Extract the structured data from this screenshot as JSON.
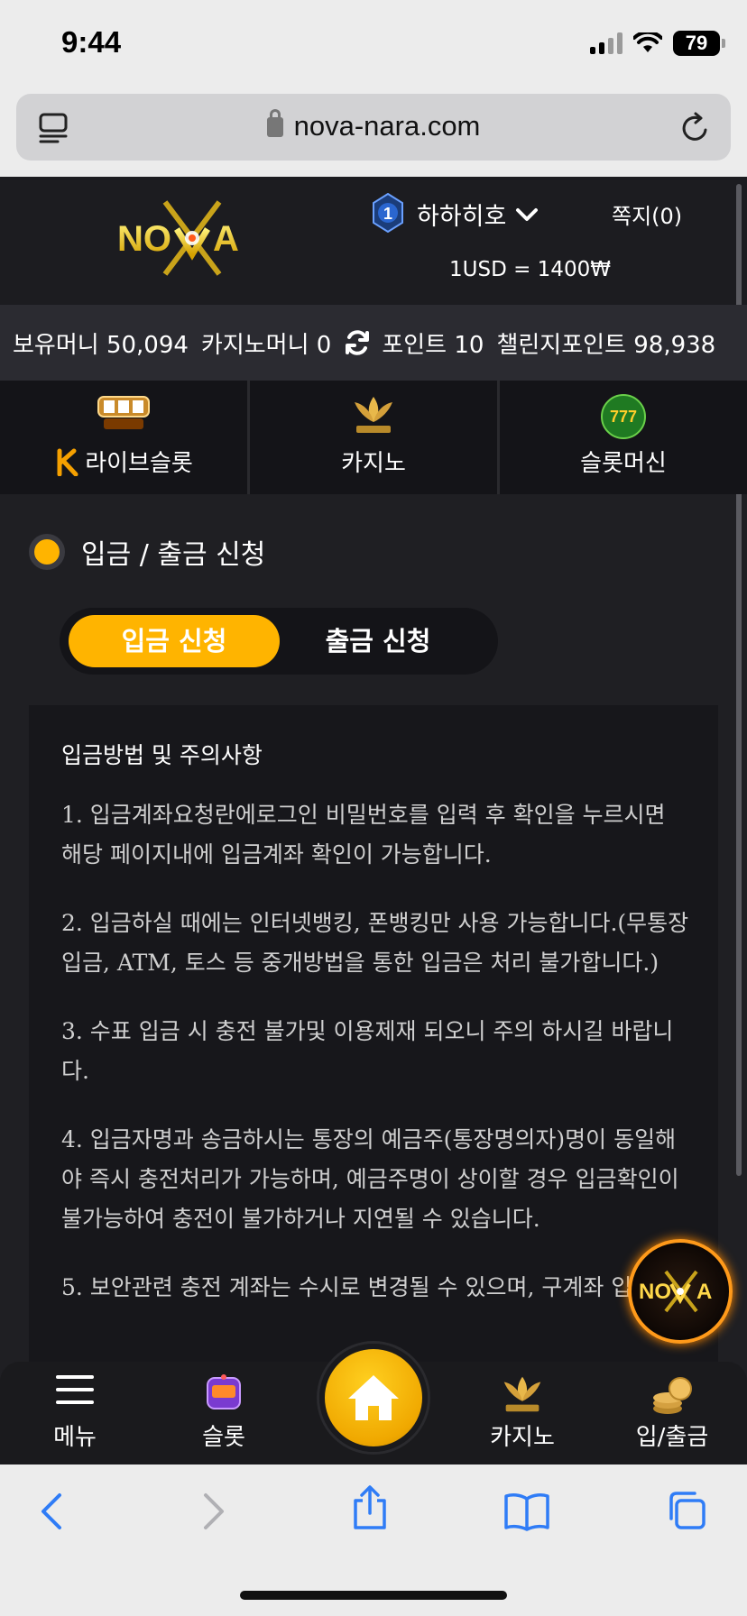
{
  "status_bar": {
    "time": "9:44",
    "battery": "79"
  },
  "browser": {
    "url": "nova-nara.com"
  },
  "header": {
    "logo_text": "NOVA",
    "username": "하하히호",
    "level": "1",
    "messages": "쪽지(0)",
    "exchange_rate": "1USD = 1400₩"
  },
  "balances": {
    "holding": "보유머니 50,094",
    "casino": "카지노머니 0",
    "points": "포인트 10",
    "challenge": "챌린지포인트 98,938"
  },
  "categories": [
    {
      "label": "라이브슬롯",
      "icon": "live-slot-icon"
    },
    {
      "label": "카지노",
      "icon": "k-slot-lotus-icon"
    },
    {
      "label": "슬롯머신",
      "icon": "777-slots-icon"
    }
  ],
  "section": {
    "title": "입금 / 출금 신청"
  },
  "toggle": {
    "deposit": "입금 신청",
    "withdraw": "출금 신청",
    "active": "deposit"
  },
  "notice": {
    "title": "입금방법 및 주의사항",
    "items": [
      "1. 입금계좌요청란에로그인 비밀번호를 입력 후 확인을 누르시면 해당 페이지내에 입금계좌 확인이 가능합니다.",
      "2. 입금하실 때에는 인터넷뱅킹, 폰뱅킹만 사용 가능합니다.(무통장입금, ATM, 토스 등 중개방법을 통한 입금은 처리 불가합니다.)",
      "3. 수표 입금 시 충전 불가및 이용제재 되오니 주의 하시길 바랍니다.",
      "4. 입금자명과 송금하시는 통장의 예금주(통장명의자)명이 동일해야 즉시 충전처리가 가능하며, 예금주명이 상이할 경우 입금확인이 불가능하여 충전이 불가하거나 지연될 수 있습니다.",
      "5. 보안관련 충전 계좌는 수시로 변경될 수 있으며, 구계좌 입금"
    ]
  },
  "bottom_nav": {
    "menu": "메뉴",
    "slot": "슬롯",
    "casino": "카지노",
    "deposit_withdraw": "입/출금"
  },
  "colors": {
    "accent": "#ffb400",
    "background": "#1f1f23",
    "browser_blue": "#2f7cf6"
  }
}
